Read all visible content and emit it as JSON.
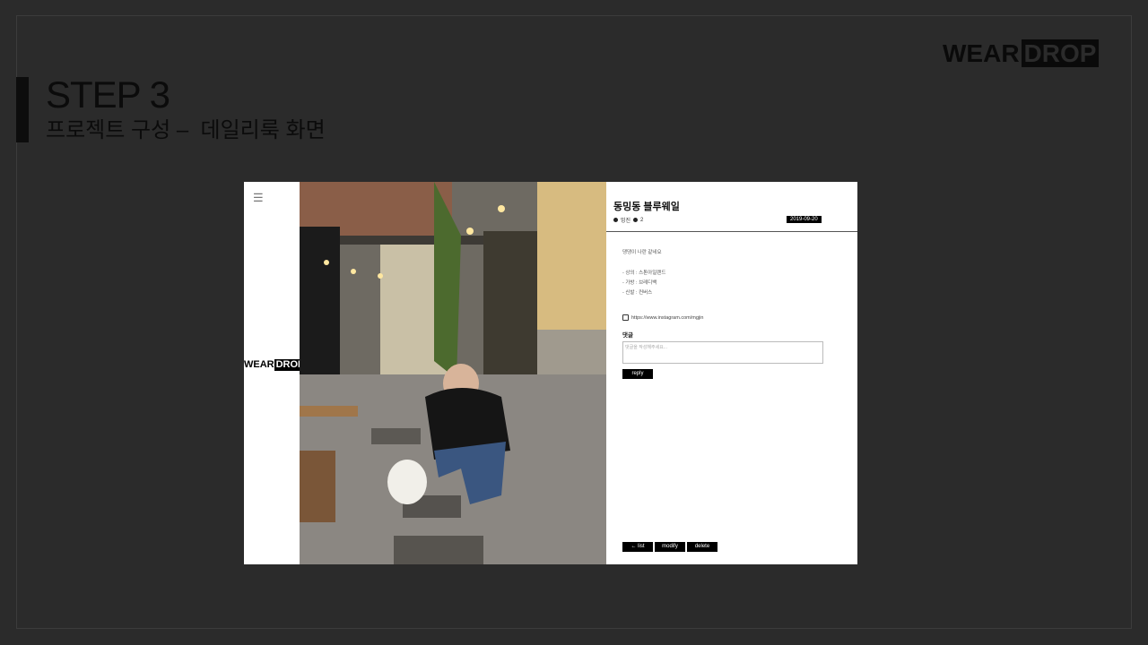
{
  "slide": {
    "step_title": "STEP 3",
    "step_subtitle": "프로젝트 구성 –  데일리룩 화면",
    "logo_wear": "WEAR",
    "logo_drop": "DROP"
  },
  "mockup": {
    "menu_icon": "hamburger-icon",
    "mini_logo_wear": "WEAR",
    "mini_logo_drop": "DROP",
    "post": {
      "title": "동밍동 블루웨일",
      "author": "밍진",
      "views": "2",
      "date": "2019-09-20",
      "body_lines": [
        "댕댕이 나란 같네요",
        "- 상의 : 스톤아일랜드",
        "- 가방 : 브레디백",
        "- 신발 : 컨버스"
      ],
      "instagram": "https://www.instagram.com/mgjin",
      "comment_label": "댓글",
      "comment_placeholder": "댓글을 작성해주세요...",
      "reply_label": "reply",
      "list_label": "← list",
      "modify_label": "modify",
      "delete_label": "delete"
    }
  },
  "colors": {
    "background": "#2b2b2b",
    "text_dark": "#0b0b0b",
    "button": "#000000"
  }
}
